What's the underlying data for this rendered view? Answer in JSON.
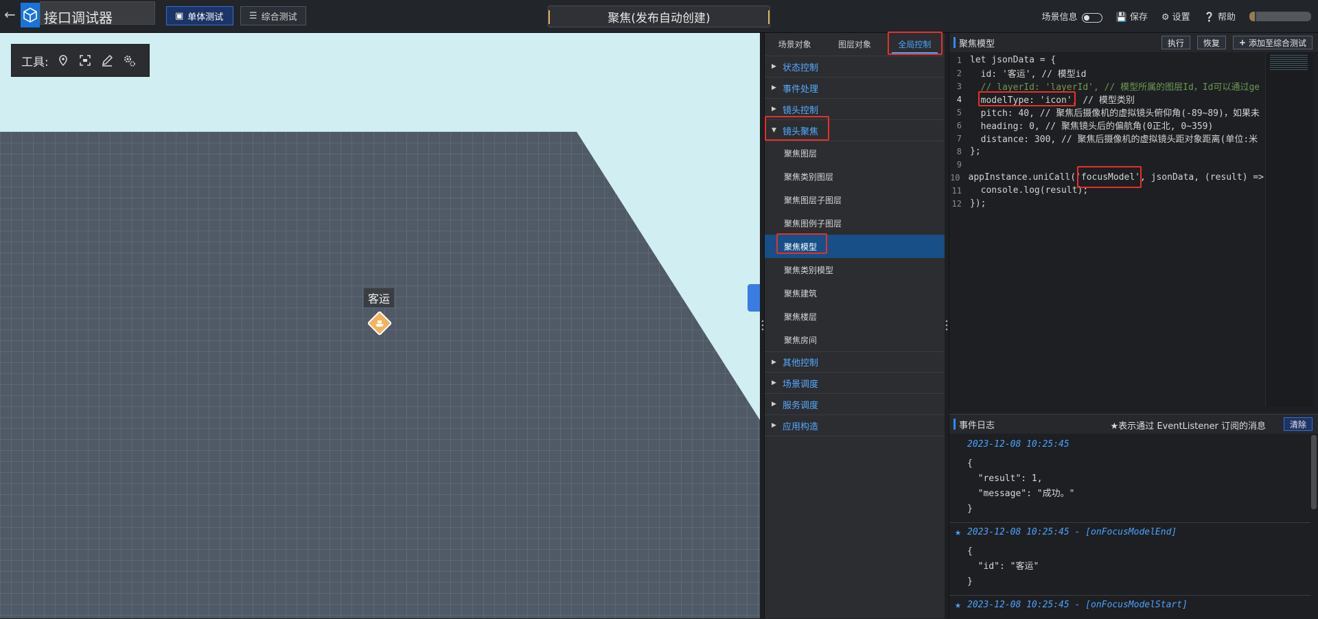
{
  "header": {
    "back_icon": "back-arrow-icon",
    "logo_icon": "cube-logo-icon",
    "app_title": "接口调试器",
    "mode_single": "单体测试",
    "mode_combined": "综合测试",
    "scene_title": "聚焦(发布自动创建)",
    "scene_info": "场景信息",
    "save": "保存",
    "settings": "设置",
    "help": "帮助"
  },
  "viewport": {
    "tools_label": "工具:",
    "marker_label": "客运"
  },
  "menu": {
    "tabs": [
      "场景对象",
      "图层对象",
      "全局控制"
    ],
    "groups_before": [
      "状态控制",
      "事件处理",
      "镜头控制"
    ],
    "expanded_group": "镜头聚焦",
    "items": [
      "聚焦图层",
      "聚焦类别图层",
      "聚焦图层子图层",
      "聚焦图例子图层",
      "聚焦模型",
      "聚焦类别模型",
      "聚焦建筑",
      "聚焦楼层",
      "聚焦房间"
    ],
    "selected_item": "聚焦模型",
    "groups_after": [
      "其他控制",
      "场景调度",
      "服务调度",
      "应用构造"
    ]
  },
  "code_panel": {
    "title": "聚焦模型",
    "execute": "执行",
    "restore": "恢复",
    "add_to_combined": "添加至综合测试",
    "line_numbers": [
      "1",
      "2",
      "3",
      "4",
      "5",
      "6",
      "7",
      "8",
      "9",
      "10",
      "11",
      "12"
    ],
    "lines": [
      "let jsonData = {",
      "  id: '客运', // 模型id",
      "  // layerId: 'layerId', // 模型所属的图层Id，Id可以通过ge",
      "  modelType: 'icon', // 模型类别",
      "  pitch: 40, // 聚焦后摄像机的虚拟镜头俯仰角(-89~89)，如果未",
      "  heading: 0, // 聚焦镜头后的偏航角(0正北, 0~359)",
      "  distance: 300, // 聚焦后摄像机的虚拟镜头距对象距离(单位:米",
      "};",
      "",
      "appInstance.uniCall('focusModel', jsonData, (result) =>",
      "  console.log(result);",
      "});"
    ]
  },
  "log_panel": {
    "title": "事件日志",
    "legend": "★表示通过 EventListener 订阅的消息",
    "clear": "清除",
    "entries": [
      {
        "time": "2023-12-08 10:25:45",
        "json": "{\n  \"result\": 1,\n  \"message\": \"成功。\"\n}"
      },
      {
        "time": "2023-12-08 10:25:45 - [onFocusModelEnd]",
        "json": "{\n  \"id\": \"客运\"\n}"
      },
      {
        "time": "2023-12-08 10:25:45 - [onFocusModelStart]",
        "json": "{"
      }
    ]
  },
  "colors": {
    "accent_blue": "#2e8bff",
    "highlight_red": "#e8302b",
    "sky": "#d1eef2",
    "ground": "#4f5a66"
  }
}
